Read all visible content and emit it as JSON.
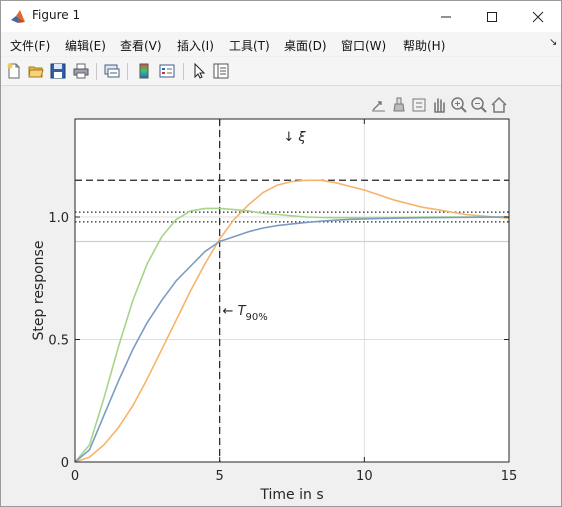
{
  "window": {
    "title": "Figure 1",
    "icon": "matlab-logo-icon"
  },
  "menu": {
    "items": [
      "文件(F)",
      "编辑(E)",
      "查看(V)",
      "插入(I)",
      "工具(T)",
      "桌面(D)",
      "窗口(W)",
      "帮助(H)"
    ],
    "overflow_glyph": "↘"
  },
  "toolbar": {
    "icons": [
      "new-figure-icon",
      "open-file-icon",
      "save-icon",
      "print-icon",
      "link-plot-icon",
      "insert-colorbar-icon",
      "insert-legend-icon",
      "edit-plot-arrow-icon",
      "property-inspector-icon"
    ]
  },
  "axes_toolbar": {
    "icons": [
      "export-icon",
      "brush-icon",
      "datatip-icon",
      "pan-hand-icon",
      "zoom-in-icon",
      "zoom-out-icon",
      "home-icon"
    ]
  },
  "chart_data": {
    "type": "line",
    "title": "",
    "xlabel": "Time in s",
    "ylabel": "Step response",
    "xlim": [
      0,
      15
    ],
    "ylim": [
      0,
      1.4
    ],
    "xticks": [
      "0",
      "5",
      "10",
      "15"
    ],
    "yticks": [
      "0",
      "0.5",
      "1.0"
    ],
    "grid": true,
    "series": [
      {
        "color": "#f7b36b",
        "x": [
          0,
          0.5,
          1,
          1.5,
          2,
          2.5,
          3,
          3.5,
          4,
          4.5,
          5,
          5.5,
          6,
          6.5,
          7,
          7.5,
          8,
          8.5,
          9,
          9.5,
          10,
          10.5,
          11,
          11.5,
          12,
          12.5,
          13,
          13.5,
          14,
          14.5,
          15
        ],
        "y": [
          0,
          0.02,
          0.07,
          0.14,
          0.23,
          0.34,
          0.46,
          0.58,
          0.7,
          0.81,
          0.91,
          0.99,
          1.05,
          1.1,
          1.13,
          1.145,
          1.15,
          1.15,
          1.14,
          1.125,
          1.11,
          1.09,
          1.07,
          1.055,
          1.04,
          1.03,
          1.02,
          1.01,
          1.005,
          1.0,
          0.995
        ]
      },
      {
        "color": "#a6d58a",
        "x": [
          0,
          0.5,
          1,
          1.5,
          2,
          2.5,
          3,
          3.5,
          4,
          4.5,
          5,
          5.5,
          6,
          6.5,
          7,
          7.5,
          8,
          8.5,
          9,
          9.5,
          10,
          11,
          12,
          13,
          14,
          15
        ],
        "y": [
          0,
          0.07,
          0.26,
          0.47,
          0.66,
          0.81,
          0.92,
          0.99,
          1.025,
          1.035,
          1.035,
          1.03,
          1.025,
          1.015,
          1.01,
          1.005,
          1.0,
          0.998,
          0.997,
          0.997,
          0.997,
          0.998,
          0.999,
          1.0,
          1.0,
          1.0
        ]
      },
      {
        "color": "#7b9cc2",
        "x": [
          0,
          0.5,
          1,
          1.5,
          2,
          2.5,
          3,
          3.5,
          4,
          4.5,
          5,
          5.5,
          6,
          6.5,
          7,
          7.5,
          8,
          8.5,
          9,
          9.5,
          10,
          11,
          12,
          13,
          14,
          15
        ],
        "y": [
          0,
          0.05,
          0.19,
          0.33,
          0.46,
          0.57,
          0.66,
          0.74,
          0.8,
          0.86,
          0.9,
          0.92,
          0.94,
          0.955,
          0.965,
          0.972,
          0.978,
          0.983,
          0.987,
          0.99,
          0.992,
          0.995,
          0.997,
          0.998,
          0.999,
          1.0
        ]
      }
    ],
    "reference_lines": [
      {
        "orientation": "vertical",
        "value": 5,
        "style": "dashed",
        "color": "#222222"
      },
      {
        "orientation": "horizontal",
        "value": 1.15,
        "style": "dashed",
        "color": "#222222"
      },
      {
        "orientation": "horizontal",
        "value": 1.02,
        "style": "dotted",
        "color": "#222222"
      },
      {
        "orientation": "horizontal",
        "value": 0.98,
        "style": "dotted",
        "color": "#222222"
      },
      {
        "orientation": "horizontal",
        "value": 0.9,
        "style": "solid-thin",
        "color": "#d0d0d0"
      }
    ],
    "annotations": [
      {
        "text": "↓ ξ",
        "x": 7.2,
        "y": 1.31
      },
      {
        "text": "← T",
        "subscript": "90%",
        "x": 5.1,
        "y": 0.6
      }
    ]
  }
}
